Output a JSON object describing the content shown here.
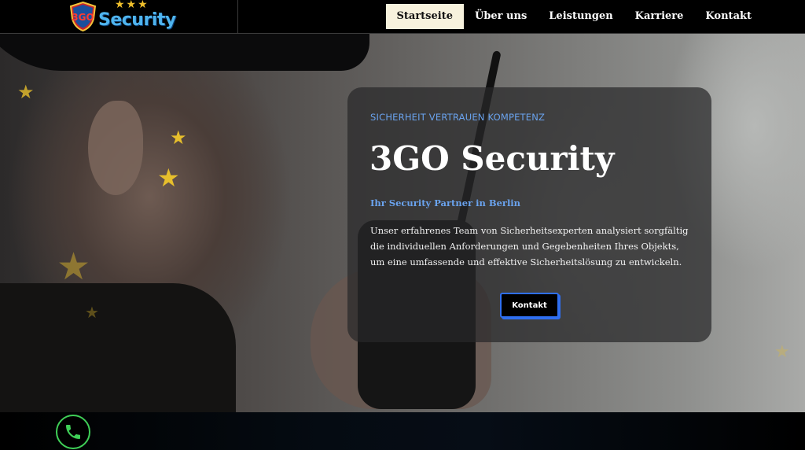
{
  "brand": {
    "logo_badge_text": "3GO",
    "logo_word": "Security",
    "logo_stars": "★★★"
  },
  "nav": {
    "items": [
      {
        "label": "Startseite",
        "active": true
      },
      {
        "label": "Über uns",
        "active": false
      },
      {
        "label": "Leistungen",
        "active": false
      },
      {
        "label": "Karriere",
        "active": false
      },
      {
        "label": "Kontakt",
        "active": false
      }
    ]
  },
  "hero": {
    "kicker": "SICHERHEIT VERTRAUEN KOMPETENZ",
    "title": "3GO Security",
    "subtitle": "Ihr Security Partner in Berlin",
    "description": "Unser erfahrenes Team von Sicherheitsexperten analysiert sorgfältig die individuellen Anforderungen und Gegebenheiten Ihres Objekts, um eine umfassende und effektive Sicherheitslösung zu entwickeln.",
    "cta_label": "Kontakt"
  },
  "floating": {
    "phone_icon": "phone-icon"
  },
  "colors": {
    "accent_blue": "#6aa3ee",
    "button_border": "#2f6ff0",
    "nav_active_bg": "#f7f2dd",
    "phone_green": "#3fcf57",
    "star_gold": "#e7bf2c"
  }
}
